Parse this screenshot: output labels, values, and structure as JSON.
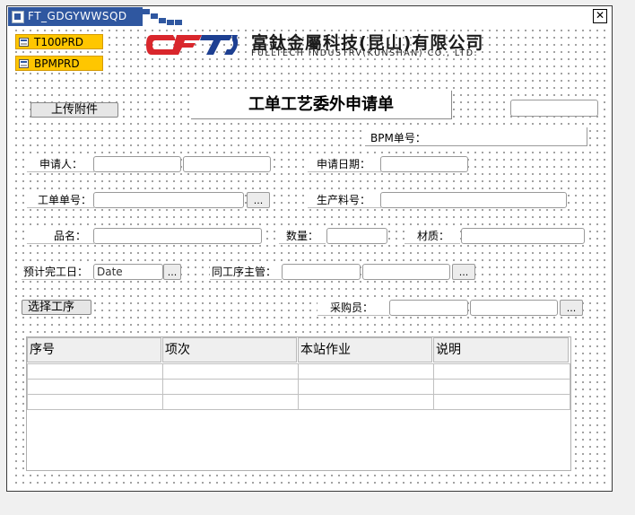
{
  "window": {
    "title": "FT_GDGYWWSQD",
    "close_label": "✕"
  },
  "connections": [
    {
      "label": "T100PRD"
    },
    {
      "label": "BPMPRD"
    }
  ],
  "logo": {
    "mark_text": "FT",
    "company_cn": "富鈦金屬科技(昆山)有限公司",
    "company_en": "FULLTECH INDUSTRV(KUNSHAN) CO., LTD."
  },
  "form": {
    "upload_button": "上传附件",
    "title": "工单工艺委外申请单",
    "bpm_label": "BPM单号：",
    "applicant_label": "申请人：",
    "apply_date_label": "申请日期：",
    "work_order_label": "工单单号：",
    "production_item_label": "生产料号：",
    "product_name_label": "品名：",
    "quantity_label": "数量：",
    "material_label": "材质：",
    "expected_finish_label": "预计完工日：",
    "expected_finish_value": "Date",
    "same_process_supervisor_label": "同工序主管：",
    "select_process_button": "选择工序",
    "buyer_label": "采购员：",
    "browse_label": "..."
  },
  "table": {
    "columns": [
      "序号",
      "项次",
      "本站作业",
      "说明"
    ],
    "rows": [
      [
        "",
        "",
        "",
        ""
      ],
      [
        "",
        "",
        "",
        ""
      ],
      [
        "",
        "",
        "",
        ""
      ]
    ]
  },
  "colors": {
    "title_tab": "#2f57a0",
    "connection_badge": "#ffc600",
    "logo_red": "#d9262c",
    "logo_blue": "#1d3f91"
  }
}
